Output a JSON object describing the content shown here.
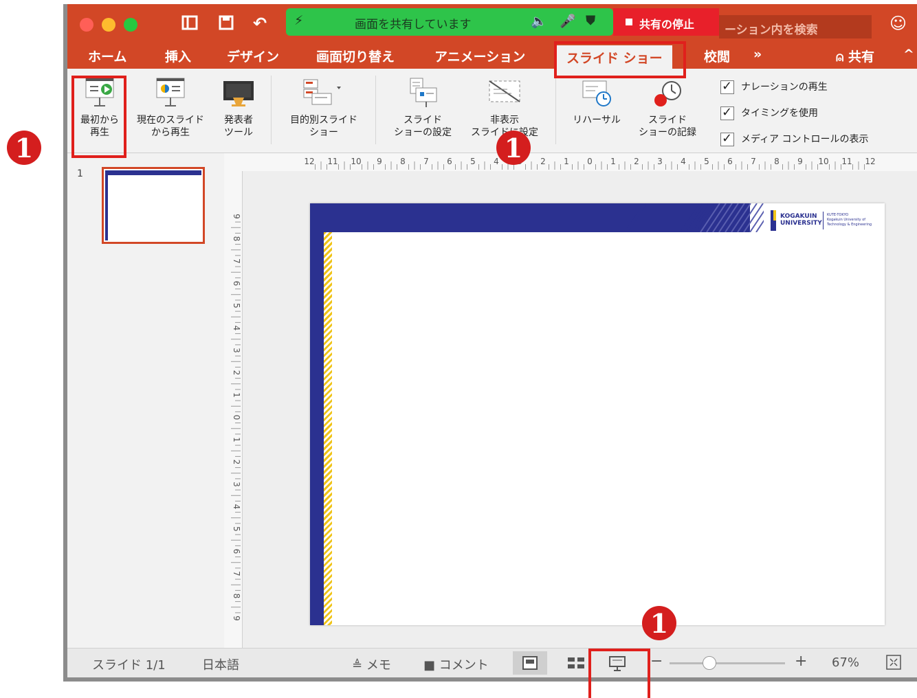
{
  "toolbar": {
    "share_status": "画面を共有しています",
    "stop_share": "共有の停止",
    "search_placeholder": "ーション内を検索"
  },
  "tabs": [
    "ホーム",
    "挿入",
    "デザイン",
    "画面切り替え",
    "アニメーション",
    "スライド ショー",
    "校閲"
  ],
  "more_tabs": "»",
  "share_label": "共有",
  "ribbon": {
    "from_beginning": [
      "最初から",
      "再生"
    ],
    "from_current": [
      "現在のスライド",
      "から再生"
    ],
    "presenter": [
      "発表者",
      "ツール"
    ],
    "custom_show": [
      "目的別スライド",
      "ショー"
    ],
    "setup_show": [
      "スライド",
      "ショーの設定"
    ],
    "hide_slide": [
      "非表示",
      "スライドに設定"
    ],
    "rehearse": "リハーサル",
    "record": [
      "スライド",
      "ショーの記録"
    ],
    "play_narration": "ナレーションの再生",
    "use_timings": "タイミングを使用",
    "show_media_controls": "メディア コントロールの表示"
  },
  "slide_number": "1",
  "status": {
    "slide_counter": "スライド 1/1",
    "language": "日本語",
    "notes": "メモ",
    "comments": "コメント",
    "zoom": "67%"
  },
  "slide_logo": {
    "name_line1": "KOGAKUIN",
    "name_line2": "UNIVERSITY",
    "sub_line1": "KUTE-TOKYO",
    "sub_line2": "Kogakuin University of",
    "sub_line3": "Technology & Engineering"
  },
  "ruler_h_labels": [
    "12",
    "11",
    "10",
    "9",
    "8",
    "7",
    "6",
    "5",
    "4",
    "3",
    "2",
    "1",
    "0",
    "1",
    "2",
    "3",
    "4",
    "5",
    "6",
    "7",
    "8",
    "9",
    "10",
    "11",
    "12"
  ],
  "ruler_v_labels": [
    "9",
    "8",
    "7",
    "6",
    "5",
    "4",
    "3",
    "2",
    "1",
    "0",
    "1",
    "2",
    "3",
    "4",
    "5",
    "6",
    "7",
    "8",
    "9"
  ],
  "annotations": {
    "badge": "1"
  },
  "colors": {
    "accent": "#d24726",
    "slide_navy": "#2b3190",
    "slide_gold": "#f0c419",
    "highlight": "#e0201c"
  }
}
